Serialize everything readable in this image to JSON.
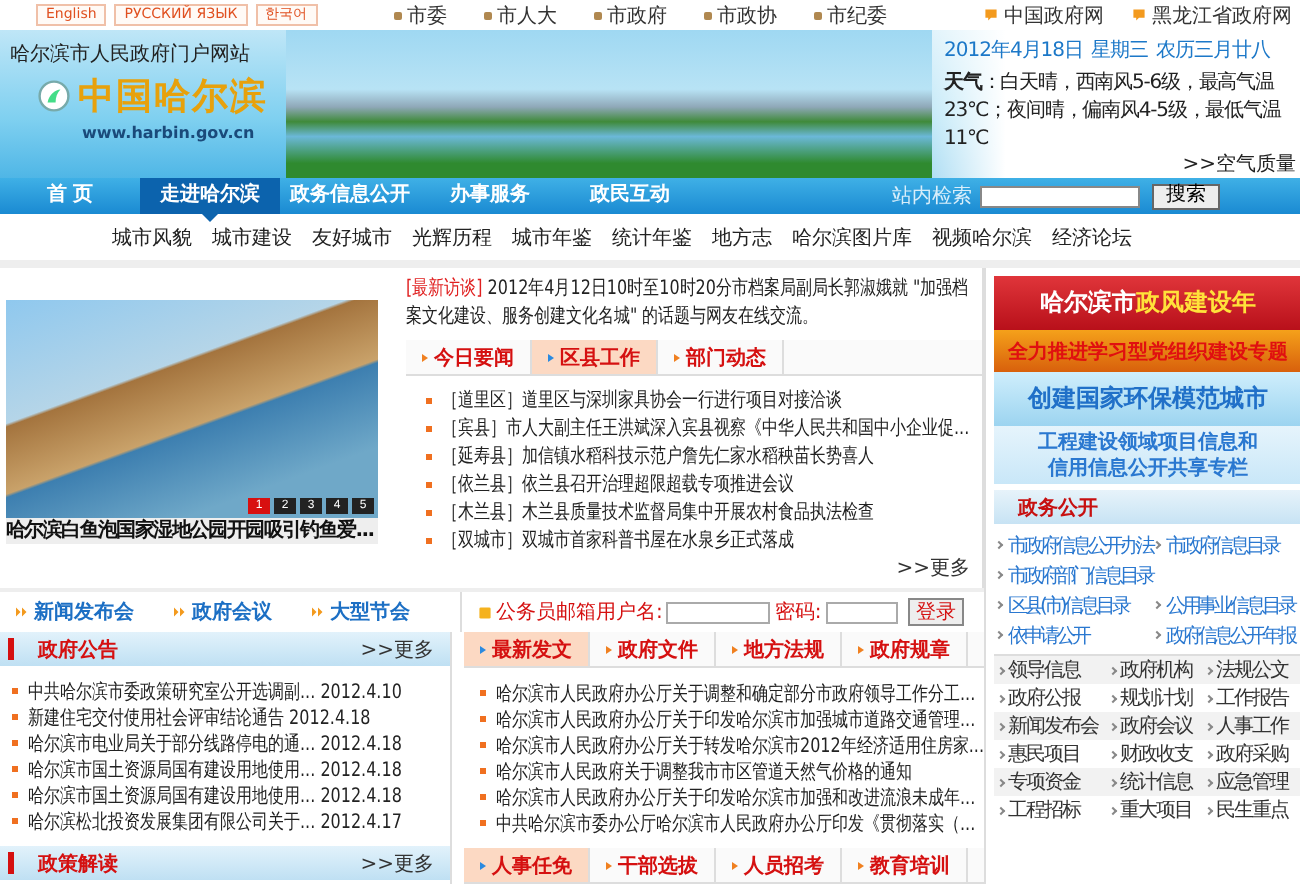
{
  "top_bar": {
    "languages": [
      "English",
      "РУССКИЙ ЯЗЫК",
      "한국어"
    ],
    "links": [
      "市委",
      "市人大",
      "市政府",
      "市政协",
      "市纪委"
    ],
    "external_links": [
      "中国政府网",
      "黑龙江省政府网"
    ]
  },
  "banner": {
    "site_name": "哈尔滨市人民政府门户网站",
    "logo": "中国哈尔滨",
    "url": "www.harbin.gov.cn",
    "date": "2012年4月18日",
    "weekday": "星期三",
    "lunar": "农历三月廿八",
    "weather": "**天气**：白天晴，西南风5-6级，最高气温23℃；夜间晴，偏南风4-5级，最低气温11℃",
    "air_quality": ">>空气质量"
  },
  "nav": {
    "items": [
      {
        "label": "首 页",
        "selected": false
      },
      {
        "label": "走进哈尔滨",
        "selected": true
      },
      {
        "label": "政务信息公开",
        "selected": false
      },
      {
        "label": "办事服务",
        "selected": false
      },
      {
        "label": "政民互动",
        "selected": false
      }
    ],
    "search_label": "站内检索",
    "search_button": "搜索"
  },
  "subnav": [
    "城市风貌",
    "城市建设",
    "友好城市",
    "光辉历程",
    "城市年鉴",
    "统计年鉴",
    "地方志",
    "哈尔滨图片库",
    "视频哈尔滨",
    "经济论坛"
  ],
  "slideshow": {
    "caption": "哈尔滨白鱼泡国家湿地公园开园吸引钓鱼爱...",
    "pages": [
      {
        "label": "1",
        "selected": true
      },
      {
        "label": "2",
        "selected": false
      },
      {
        "label": "3",
        "selected": false
      },
      {
        "label": "4",
        "selected": false
      },
      {
        "label": "5",
        "selected": false
      }
    ]
  },
  "interview": {
    "tag": "[最新访谈]",
    "text": "2012年4月12日10时至10时20分市档案局副局长郭淑娥就 \"加强档案文化建设、服务创建文化名城\" 的话题与网友在线交流。"
  },
  "news": {
    "tabs": [
      {
        "label": "今日要闻",
        "selected": false
      },
      {
        "label": "区县工作",
        "selected": true
      },
      {
        "label": "部门动态",
        "selected": false
      }
    ],
    "items": [
      {
        "region": "［道里区］",
        "title": "道里区与深圳家具协会一行进行项目对接洽谈"
      },
      {
        "region": "［宾县］",
        "title": "市人大副主任王洪斌深入宾县视察《中华人民共和国中小企业促..."
      },
      {
        "region": "［延寿县］",
        "title": "加信镇水稻科技示范户詹先仁家水稻秧苗长势喜人"
      },
      {
        "region": "［依兰县］",
        "title": "依兰县召开治理超限超载专项推进会议"
      },
      {
        "region": "［木兰县］",
        "title": "木兰县质量技术监督局集中开展农村食品执法检查"
      },
      {
        "region": "［双城市］",
        "title": "双城市首家科普书屋在水泉乡正式落成"
      }
    ],
    "more": ">>更多"
  },
  "quick_links": [
    "新闻发布会",
    "政府会议",
    "大型节会"
  ],
  "login": {
    "username_label": "公务员邮箱用户名:",
    "password_label": "密码:",
    "button": "登录"
  },
  "announcements": {
    "title": "政府公告",
    "more": ">>更多",
    "items": [
      {
        "title": "中共哈尔滨市委政策研究室公开选调副...",
        "date": "2012.4.10"
      },
      {
        "title": "新建住宅交付使用社会评审结论通告",
        "date": "2012.4.18"
      },
      {
        "title": "哈尔滨市电业局关于部分线路停电的通...",
        "date": "2012.4.18"
      },
      {
        "title": "哈尔滨市国土资源局国有建设用地使用...",
        "date": "2012.4.18"
      },
      {
        "title": "哈尔滨市国土资源局国有建设用地使用...",
        "date": "2012.4.18"
      },
      {
        "title": "哈尔滨松北投资发展集团有限公司关于...",
        "date": "2012.4.17"
      }
    ]
  },
  "documents": {
    "tabs": [
      {
        "label": "最新发文",
        "selected": true
      },
      {
        "label": "政府文件",
        "selected": false
      },
      {
        "label": "地方法规",
        "selected": false
      },
      {
        "label": "政府规章",
        "selected": false
      }
    ],
    "items": [
      "哈尔滨市人民政府办公厅关于调整和确定部分市政府领导工作分工...",
      "哈尔滨市人民政府办公厅关于印发哈尔滨市加强城市道路交通管理...",
      "哈尔滨市人民政府办公厅关于转发哈尔滨市2012年经济适用住房家...",
      "哈尔滨市人民政府关于调整我市市区管道天然气价格的通知",
      "哈尔滨市人民政府办公厅关于印发哈尔滨市加强和改进流浪未成年...",
      "中共哈尔滨市委办公厅哈尔滨市人民政府办公厅印发《贯彻落实（..."
    ]
  },
  "policy": {
    "title": "政策解读",
    "more": ">>更多"
  },
  "personnel": {
    "tabs": [
      {
        "label": "人事任免",
        "selected": true
      },
      {
        "label": "干部选拔",
        "selected": false
      },
      {
        "label": "人员招考",
        "selected": false
      },
      {
        "label": "教育培训",
        "selected": false
      }
    ]
  },
  "promos": [
    {
      "kind": "red",
      "text": "哈尔滨市",
      "highlight": "政风建设年"
    },
    {
      "kind": "orange",
      "text": "全力推进学习型党组织建设专题"
    },
    {
      "kind": "sky",
      "text": "创建国家环保模范城市"
    },
    {
      "kind": "pale",
      "text": "工程建设领域项目信息和",
      "text2": "信用信息公开共享专栏"
    }
  ],
  "open_gov": {
    "title": "政务公开",
    "links": [
      "市政府信息公开办法",
      "市政府信息目录",
      "市政府部门信息目录",
      "区县(市)信息目录",
      "公用事业信息目录",
      "依申请公开",
      "政府信息公开年报"
    ],
    "grid": [
      "领导信息",
      "政府机构",
      "法规公文",
      "政府公报",
      "规划计划",
      "工作报告",
      "新闻发布会",
      "政府会议",
      "人事工作",
      "惠民项目",
      "财政收支",
      "政府采购",
      "专项资金",
      "统计信息",
      "应急管理",
      "工程招标",
      "重大项目",
      "民生重点"
    ]
  }
}
